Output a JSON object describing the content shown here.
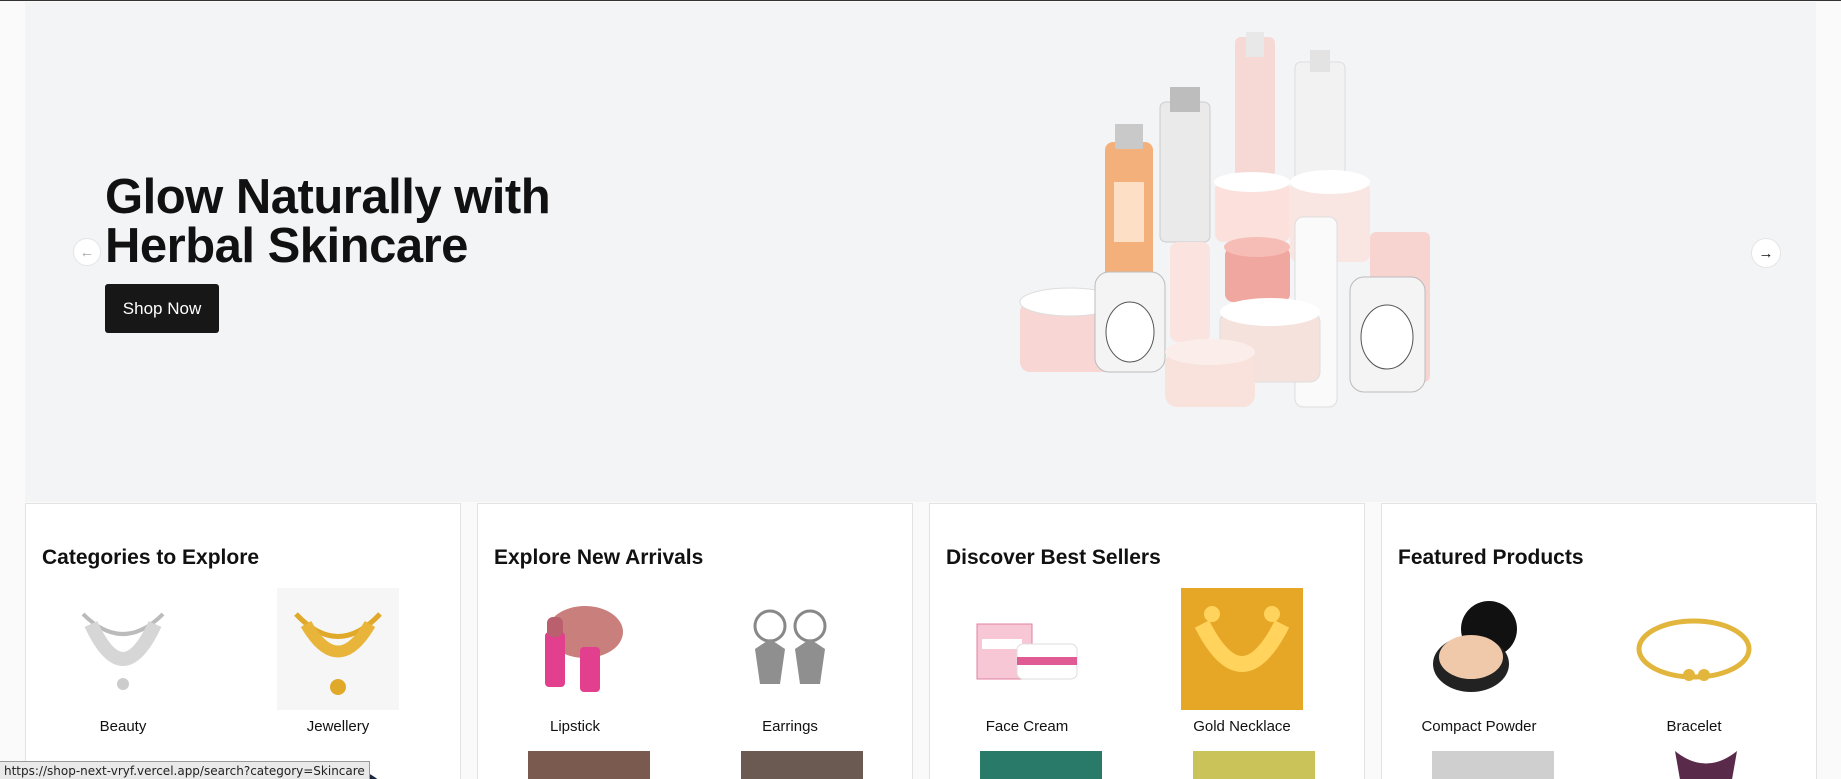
{
  "hero": {
    "title_line1": "Glow Naturally with",
    "title_line2": "Herbal Skincare",
    "cta": "Shop Now",
    "prev_icon": "arrow-left-icon",
    "next_icon": "arrow-right-icon"
  },
  "cards": [
    {
      "title": "Categories to Explore",
      "items": [
        {
          "label": "Beauty"
        },
        {
          "label": "Jewellery"
        }
      ]
    },
    {
      "title": "Explore New Arrivals",
      "items": [
        {
          "label": "Lipstick"
        },
        {
          "label": "Earrings"
        }
      ]
    },
    {
      "title": "Discover Best Sellers",
      "items": [
        {
          "label": "Face Cream"
        },
        {
          "label": "Gold Necklace"
        }
      ]
    },
    {
      "title": "Featured Products",
      "items": [
        {
          "label": "Compact Powder"
        },
        {
          "label": "Bracelet"
        }
      ]
    }
  ],
  "status_bar": {
    "url": "https://shop-next-vryf.vercel.app/search?category=Skincare"
  },
  "colors": {
    "hero_bg": "#f3f4f6",
    "button_bg": "#171717",
    "gold": "#e0a92a"
  }
}
